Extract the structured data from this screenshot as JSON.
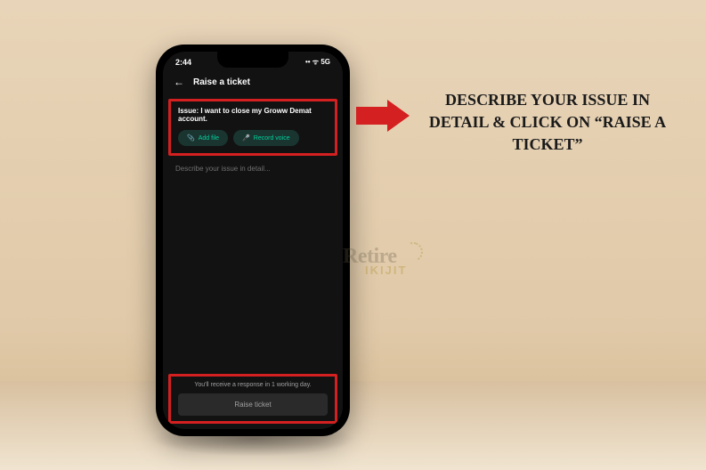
{
  "status": {
    "time": "2:44",
    "icons": "•• ᯤ 5G"
  },
  "header": {
    "title": "Raise a ticket"
  },
  "issue": {
    "label": "Issue: I want to close my Groww Demat account."
  },
  "buttons": {
    "add_file": "Add file",
    "record_voice": "Record voice"
  },
  "textarea": {
    "placeholder": "Describe your issue in detail..."
  },
  "footer": {
    "note": "You'll receive a response in 1 working day.",
    "button": "Raise ticket"
  },
  "instruction": {
    "text": "DESCRIBE YOUR ISSUE IN DETAIL & CLICK ON “RAISE A TICKET”"
  },
  "watermark": {
    "main": "Retire",
    "sub": "IKIJIT"
  }
}
